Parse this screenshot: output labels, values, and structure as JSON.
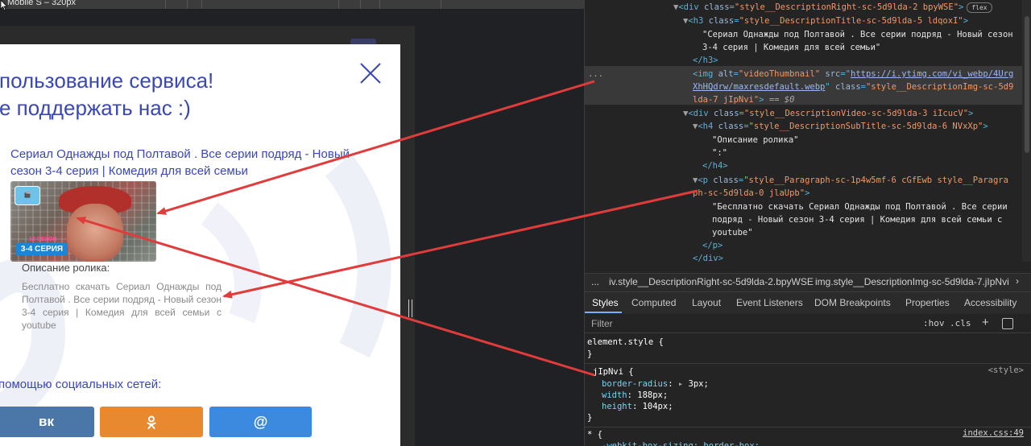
{
  "device": {
    "label": "Mobile S – 320px"
  },
  "modal": {
    "title_lines": [
      "пользование сервиса!",
      "е поддержать нас :)"
    ],
    "description_title": "Сериал Однажды под Полтавой . Все серии подряд - Новый сезон 3-4 серия | Комедия для всей семьи",
    "thumbnail": {
      "logo_text": "🎬",
      "badge_top": "12 СЕЗОН",
      "badge_main": "3-4 СЕРИЯ"
    },
    "subtitle": "Описание ролика:",
    "paragraph": "Бесплатно скачать Сериал Однажды под Полтавой . Все серии подряд - Новый сезон 3-4 серия | Комедия для всей семьи с youtube",
    "social_title": "помощью социальных сетей:",
    "social_buttons": {
      "vk": "вк",
      "ok": "ok",
      "mail": "@"
    }
  },
  "elements_tree": {
    "l1": {
      "tag_open": "<div ",
      "attr": "class",
      "value": "\"style__DescriptionRight-sc-5d9lda-2 bpyWSE\"",
      "close": ">",
      "badge": "flex"
    },
    "l2": {
      "tag_open": "<h3 ",
      "attr": "class",
      "value": "\"style__DescriptionTitle-sc-5d9lda-5 ldqoxI\"",
      "close": ">"
    },
    "l3": "\"Сериал Однажды под Полтавой . Все серии подряд - Новый сезон",
    "l4": "3-4 серия | Комедия для всей семьи\"",
    "l5": "</h3>",
    "l6": {
      "tag_open": "<img ",
      "attr1": "alt",
      "value1": "\"videoThumbnail\"",
      "attr2": "src",
      "link": "https://i.ytimg.com/vi_webp/4Urg"
    },
    "l7": {
      "link": "XhHQdrw/maxresdefault.webp",
      "attr": "class",
      "value": "\"style__DescriptionImg-sc-5d9"
    },
    "l8": {
      "value": "lda-7 jIpNvi\"",
      "close": ">",
      "eq": "== $0"
    },
    "l9": {
      "tag_open": "<div ",
      "attr": "class",
      "value": "\"style__DescriptionVideo-sc-5d9lda-3 iIcucV\"",
      "close": ">"
    },
    "l10": {
      "tag_open": "<h4 ",
      "attr": "class",
      "value": "\"style__DescriptionSubTitle-sc-5d9lda-6 NVxXp\"",
      "close": ">"
    },
    "l11": "\"Описание ролика\"",
    "l12": "\":\"",
    "l13": "</h4>",
    "l14": {
      "tag_open": "<p ",
      "attr": "class",
      "value": "\"style__Paragraph-sc-1p4w5mf-6 cGfEwb style__Paragra"
    },
    "l15": {
      "value": "ph-sc-5d9lda-0 jlaUpb\"",
      "close": ">"
    },
    "l16": "\"Бесплатно скачать Сериал Однажды под Полтавой . Все серии",
    "l17": "подряд - Новый сезон 3-4 серия | Комедия для всей семьи с",
    "l18": "youtube\"",
    "l19": "</p>",
    "l20": "</div>",
    "ellipsis": "..."
  },
  "breadcrumb": {
    "ellipsis": "...",
    "item1": "iv.style__DescriptionRight-sc-5d9lda-2.bpyWSE",
    "item2": "img.style__DescriptionImg-sc-5d9lda-7.jIpNvi"
  },
  "tabs": [
    "Styles",
    "Computed",
    "Layout",
    "Event Listeners",
    "DOM Breakpoints",
    "Properties",
    "Accessibility"
  ],
  "filter": {
    "placeholder": "Filter",
    "hov": ":hov",
    "cls": ".cls",
    "plus": "+"
  },
  "styles": {
    "rule1_selector": "element.style {",
    "rule1_close": "}",
    "rule2_selector": "jIpNvi {",
    "rule2_source": "<style>",
    "props": [
      {
        "name": "border-radius",
        "value": "3px"
      },
      {
        "name": "width",
        "value": "188px"
      },
      {
        "name": "height",
        "value": "104px"
      }
    ],
    "rule2_close": "}",
    "rule3_selector": "* {",
    "rule3_source": "index.css:49",
    "rule3_partial": "-webkit-box-sizing: border-box;"
  },
  "colors": {
    "annotation_arrow": "#e03c3c",
    "accent_blue": "#3a47b8"
  }
}
